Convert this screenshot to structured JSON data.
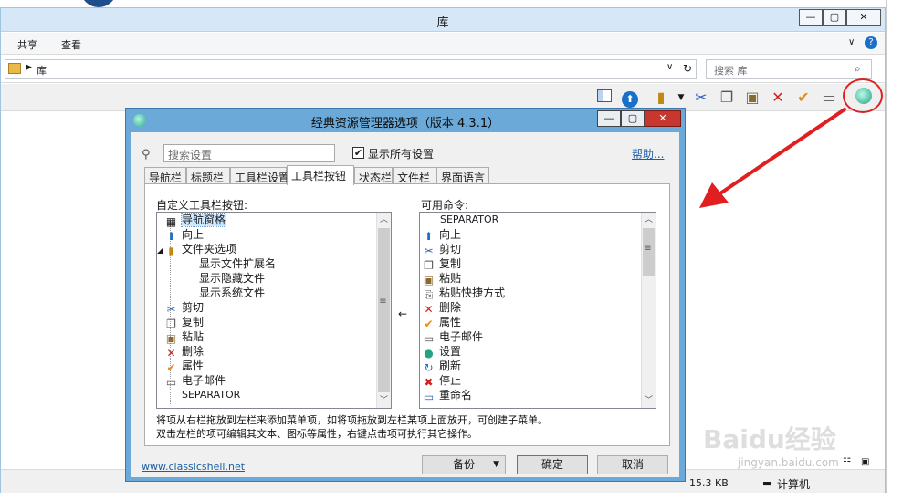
{
  "explorer": {
    "title": "库",
    "minimize": "—",
    "maximize": "▢",
    "close": "✕",
    "ribbon_tabs": [
      "共享",
      "查看"
    ],
    "address": "库",
    "search_placeholder": "搜索 库",
    "status_size": "15.3 KB",
    "status_location": "计算机"
  },
  "dialog": {
    "title": "经典资源管理器选项（版本 4.3.1）",
    "search_placeholder": "搜索设置",
    "show_all_label": "显示所有设置",
    "show_all_checked": true,
    "help_link": "帮助...",
    "tabs": [
      "导航栏",
      "标题栏",
      "工具栏设置",
      "工具栏按钮",
      "状态栏",
      "文件栏",
      "界面语言"
    ],
    "active_tab": "工具栏按钮",
    "left_label": "自定义工具栏按钮:",
    "right_label": "可用命令:",
    "left_items": [
      {
        "text": "导航窗格",
        "icon": "nav-pane-icon",
        "glyph": "▦",
        "indent": 0,
        "selected": true
      },
      {
        "text": "向上",
        "icon": "up-icon",
        "glyph": "⬆",
        "indent": 0
      },
      {
        "text": "文件夹选项",
        "icon": "folder-options-icon",
        "glyph": "📁",
        "indent": 0,
        "expanded": true
      },
      {
        "text": "显示文件扩展名",
        "icon": "",
        "glyph": "",
        "indent": 1
      },
      {
        "text": "显示隐藏文件",
        "icon": "",
        "glyph": "",
        "indent": 1
      },
      {
        "text": "显示系统文件",
        "icon": "",
        "glyph": "",
        "indent": 1
      },
      {
        "text": "剪切",
        "icon": "cut-icon",
        "glyph": "✂",
        "indent": 0
      },
      {
        "text": "复制",
        "icon": "copy-icon",
        "glyph": "❐",
        "indent": 0
      },
      {
        "text": "粘贴",
        "icon": "paste-icon",
        "glyph": "📋",
        "indent": 0
      },
      {
        "text": "删除",
        "icon": "delete-icon",
        "glyph": "✕",
        "indent": 0
      },
      {
        "text": "属性",
        "icon": "properties-icon",
        "glyph": "✔",
        "indent": 0
      },
      {
        "text": "电子邮件",
        "icon": "email-icon",
        "glyph": "✉",
        "indent": 0
      },
      {
        "text": "SEPARATOR",
        "icon": "",
        "glyph": "",
        "indent": 0
      }
    ],
    "right_items": [
      {
        "text": "SEPARATOR",
        "icon": "",
        "glyph": ""
      },
      {
        "text": "向上",
        "icon": "up-icon",
        "glyph": "⬆"
      },
      {
        "text": "剪切",
        "icon": "cut-icon",
        "glyph": "✂"
      },
      {
        "text": "复制",
        "icon": "copy-icon",
        "glyph": "❐"
      },
      {
        "text": "粘贴",
        "icon": "paste-icon",
        "glyph": "📋"
      },
      {
        "text": "粘贴快捷方式",
        "icon": "paste-shortcut-icon",
        "glyph": "⎘"
      },
      {
        "text": "删除",
        "icon": "delete-icon",
        "glyph": "✕"
      },
      {
        "text": "属性",
        "icon": "properties-icon",
        "glyph": "✔"
      },
      {
        "text": "电子邮件",
        "icon": "email-icon",
        "glyph": "✉"
      },
      {
        "text": "设置",
        "icon": "settings-icon",
        "glyph": "●"
      },
      {
        "text": "刷新",
        "icon": "refresh-icon",
        "glyph": "↻"
      },
      {
        "text": "停止",
        "icon": "stop-icon",
        "glyph": "✖"
      },
      {
        "text": "重命名",
        "icon": "rename-icon",
        "glyph": "▭"
      }
    ],
    "move_arrow": "←",
    "description_line1": "将项从右栏拖放到左栏来添加菜单项，如将项拖放到左栏某项上面放开，可创建子菜单。",
    "description_line2": "双击左栏的项可编辑其文本、图标等属性，右键点击项可执行其它操作。",
    "footer_link": "www.classicshell.net",
    "backup_button": "备份",
    "ok_button": "确定",
    "cancel_button": "取消"
  },
  "watermark": {
    "main": "Baidu经验",
    "sub": "jingyan.baidu.com"
  },
  "colors": {
    "highlight_red": "#e02020",
    "dialog_frame": "#6aa9d8",
    "link": "#1a5ea8"
  }
}
